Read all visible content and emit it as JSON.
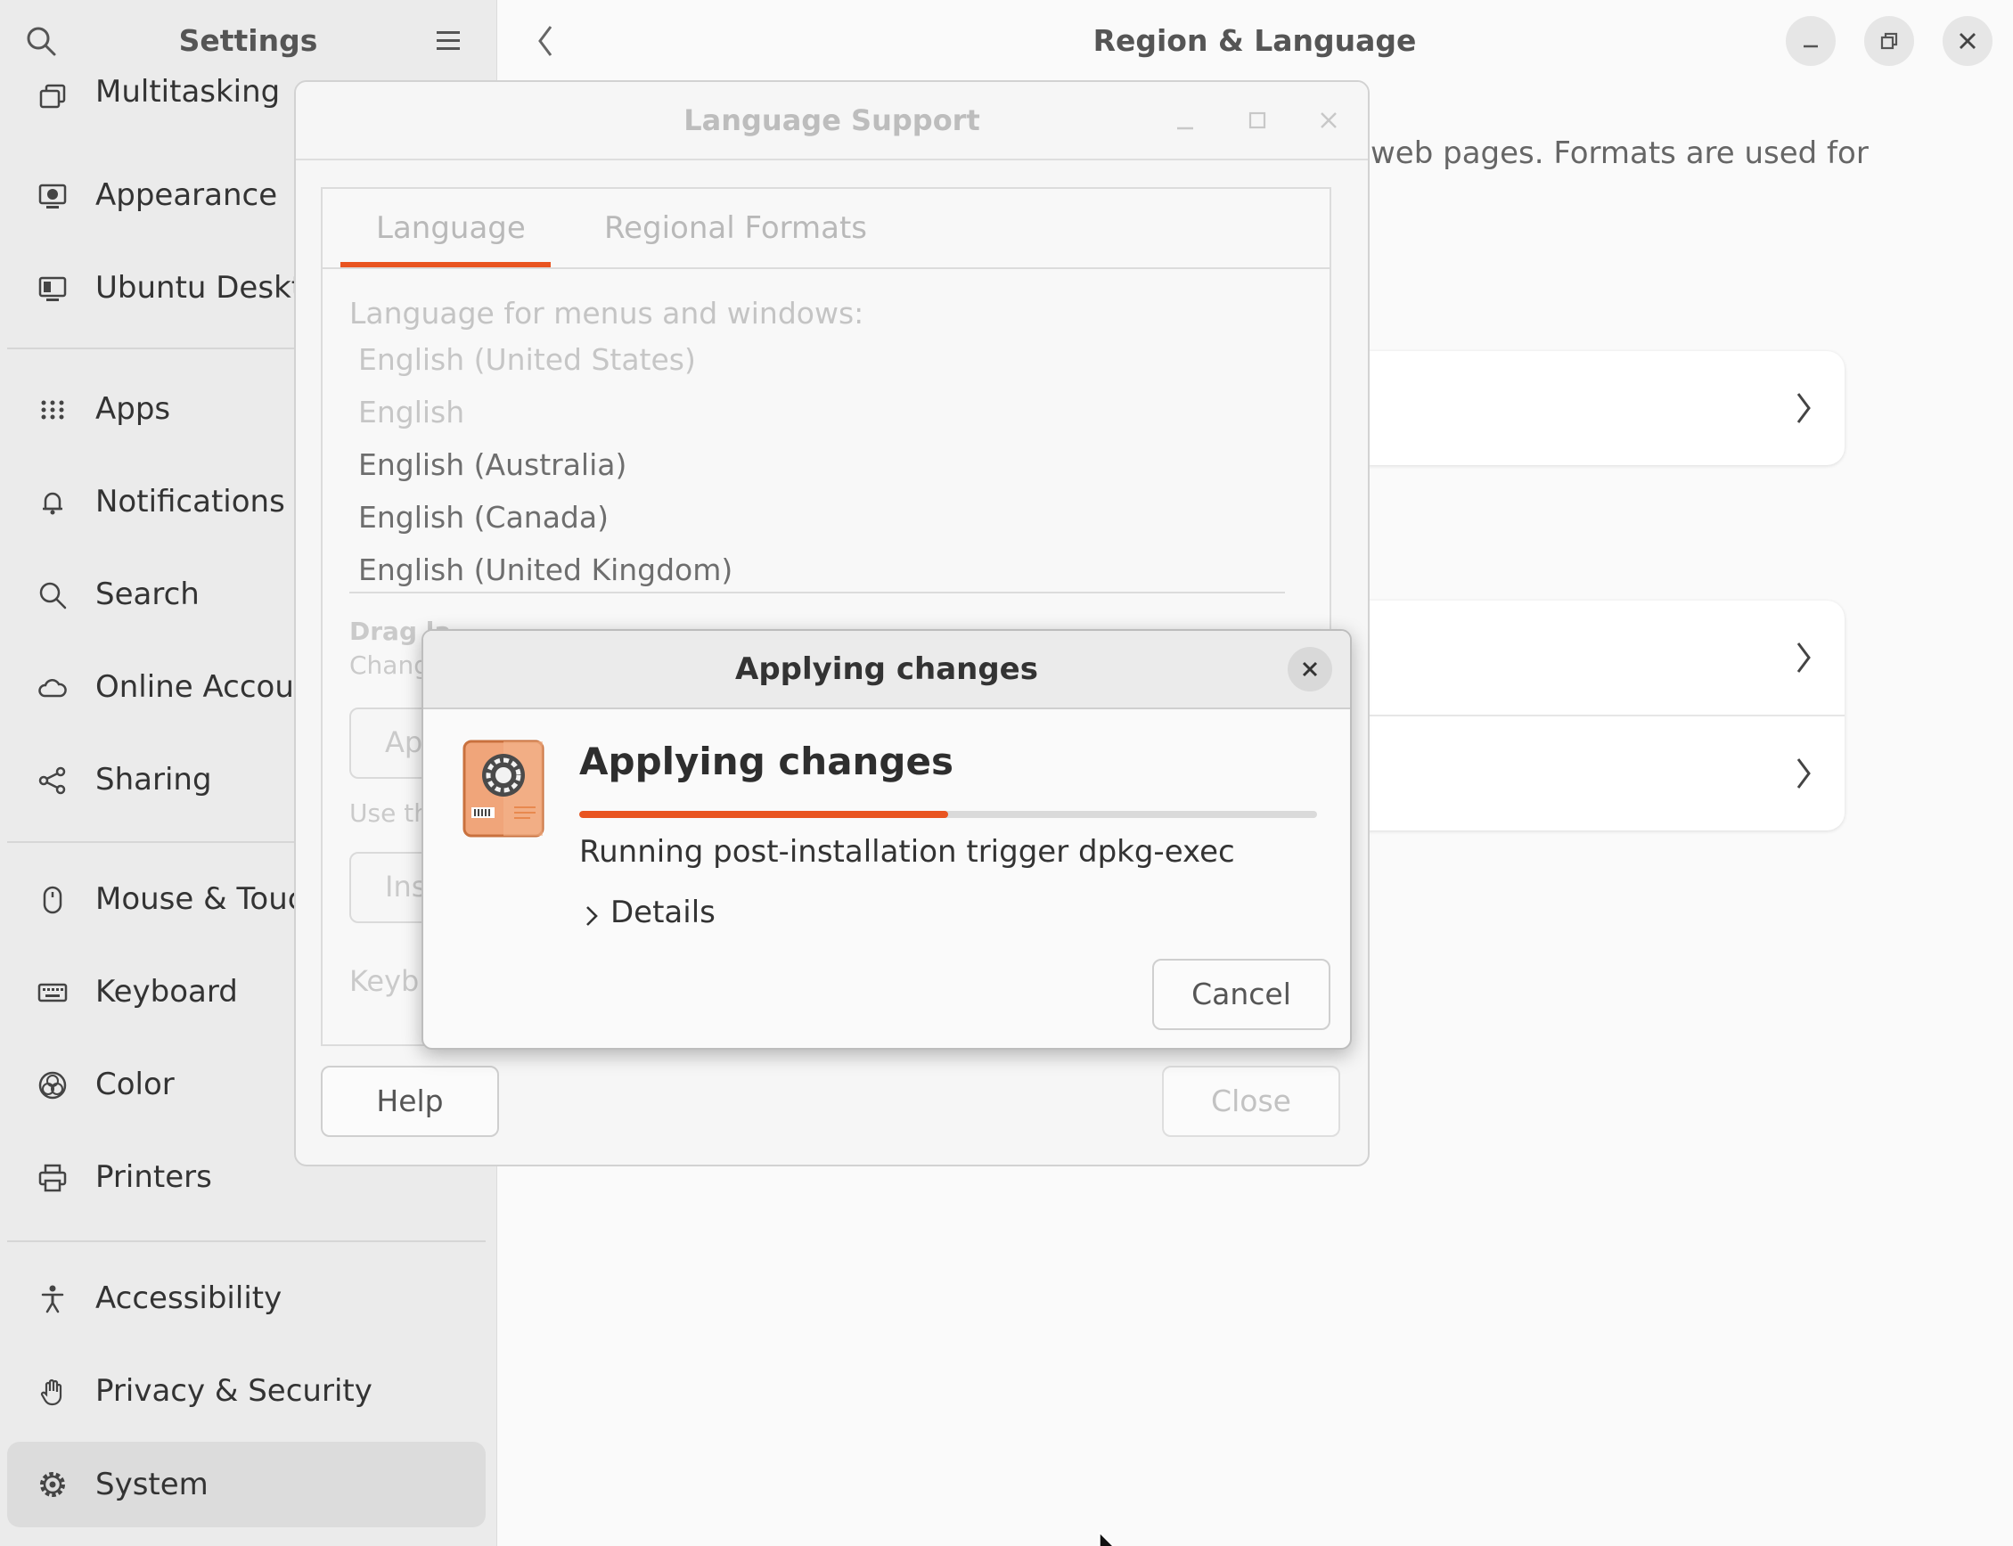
{
  "settings": {
    "title": "Settings",
    "items": [
      {
        "label": "Multitasking",
        "icon": "multitasking-icon"
      },
      {
        "label": "Appearance",
        "icon": "appearance-icon"
      },
      {
        "label": "Ubuntu Desktop",
        "icon": "ubuntu-desktop-icon"
      },
      {
        "label": "Apps",
        "icon": "apps-icon"
      },
      {
        "label": "Notifications",
        "icon": "bell-icon"
      },
      {
        "label": "Search",
        "icon": "search-icon"
      },
      {
        "label": "Online Accounts",
        "icon": "cloud-icon"
      },
      {
        "label": "Sharing",
        "icon": "share-icon"
      },
      {
        "label": "Mouse & Touchpad",
        "icon": "mouse-icon"
      },
      {
        "label": "Keyboard",
        "icon": "keyboard-icon"
      },
      {
        "label": "Color",
        "icon": "color-icon"
      },
      {
        "label": "Printers",
        "icon": "printer-icon"
      },
      {
        "label": "Accessibility",
        "icon": "accessibility-icon"
      },
      {
        "label": "Privacy & Security",
        "icon": "hand-icon"
      },
      {
        "label": "System",
        "icon": "gear-icon",
        "selected": true
      }
    ]
  },
  "main": {
    "title": "Region & Language",
    "description_visible": "web pages. Formats are used for"
  },
  "language_support": {
    "title": "Language Support",
    "tabs": [
      "Language",
      "Regional Formats"
    ],
    "active_tab": "Language",
    "heading": "Language for menus and windows:",
    "languages": [
      {
        "label": "English (United States)",
        "dim": true
      },
      {
        "label": "English",
        "dim": true
      },
      {
        "label": "English (Australia)",
        "dim": false
      },
      {
        "label": "English (Canada)",
        "dim": false
      },
      {
        "label": "English (United Kingdom)",
        "dim": false
      }
    ],
    "drag_hint_fragment": "Drag la",
    "change_hint_fragment": "Chang",
    "apply_button_fragment": "Ap",
    "use_hint_fragment": "Use th",
    "install_button_fragment": "Ins",
    "keyboard_label_fragment": "Keyb",
    "help_label": "Help",
    "close_label": "Close"
  },
  "applying_dialog": {
    "title": "Applying changes",
    "heading": "Applying changes",
    "progress": 0.5,
    "status": "Running post-installation trigger dpkg-exec",
    "details_label": "Details",
    "cancel_label": "Cancel"
  },
  "colors": {
    "accent": "#e95420",
    "sidebar_bg": "#ebebeb",
    "window_bg": "#fafafa"
  }
}
